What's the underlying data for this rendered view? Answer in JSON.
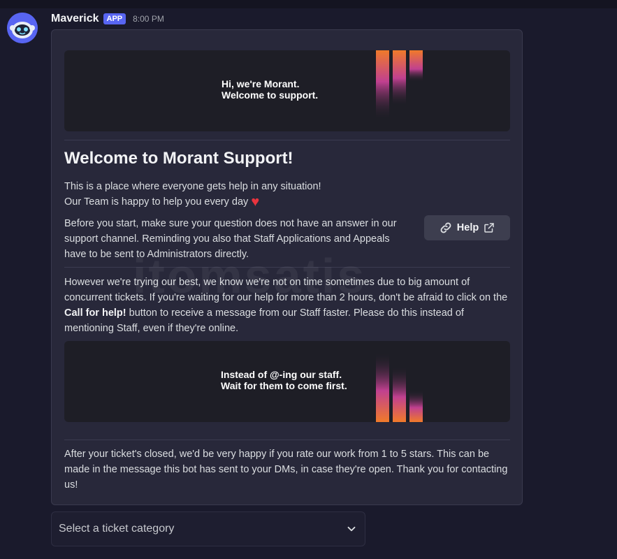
{
  "message": {
    "author": "Maverick",
    "badge": "APP",
    "timestamp": "8:00 PM"
  },
  "embed": {
    "banner_top": {
      "line1": "Hi, we're Morant.",
      "line2": "Welcome to support."
    },
    "title": "Welcome to Morant Support!",
    "p1_line1": "This is a place where everyone gets help in any situation!",
    "p1_line2": "Our Team is happy to help you every day",
    "p1_heart": "♥",
    "p2": "Before you start, make sure your question does not have an answer in our support channel. Reminding you also that Staff Applications and Appeals have to be sent to Administrators directly.",
    "help_button": "Help",
    "p3_before": "However we're trying our best, we know we're not on time sometimes due to big amount of concurrent tickets. If you're waiting for our help for more than 2 hours, don't be afraid to click on the ",
    "p3_bold": "Call for help!",
    "p3_after": " button to receive a message from our Staff faster. Please do this instead of mentioning Staff, even if they're online.",
    "banner_mid": {
      "line1": "Instead of @-ing our staff.",
      "line2": "Wait for them to come first."
    },
    "p4": "After your ticket's closed, we'd be very happy if you rate our work from 1 to 5 stars. This can be made in the message this bot has sent to your DMs, in case they're open. Thank you for contacting us!"
  },
  "select": {
    "placeholder": "Select a ticket category"
  },
  "watermark": "itomsatis",
  "colors": {
    "accent": "#5865f2",
    "heart": "#e8343e",
    "embed_bg": "#28283a",
    "page_bg": "#1a1a2c"
  },
  "icons": {
    "avatar": "bot-avatar-icon",
    "help_link": "link-icon",
    "help_external": "external-link-icon",
    "select_chevron": "chevron-down-icon"
  }
}
